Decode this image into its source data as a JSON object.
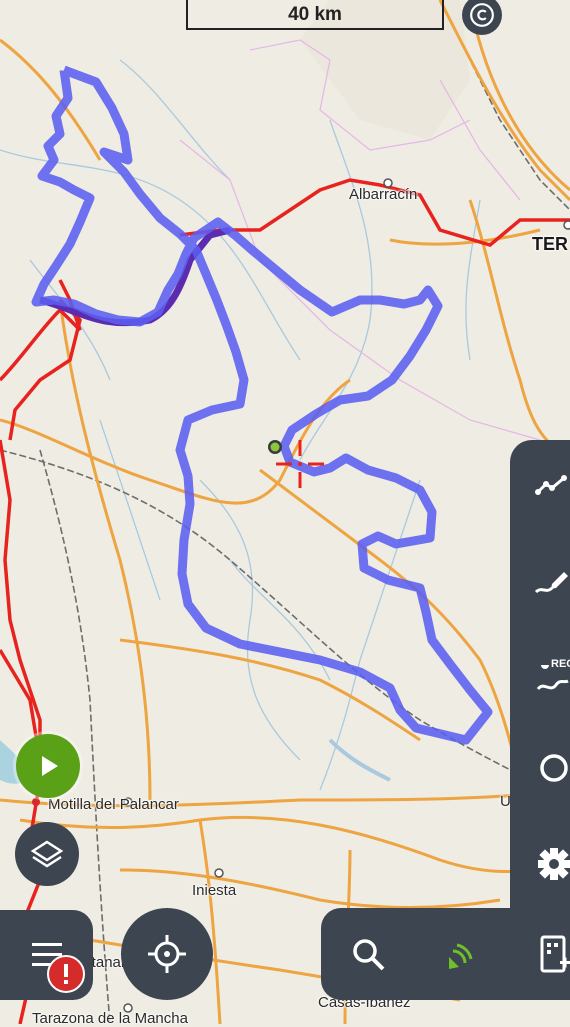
{
  "map": {
    "scale_label": "40 km",
    "places": [
      {
        "id": "albarracin",
        "name": "Albarracín"
      },
      {
        "id": "teruel",
        "name": "TER"
      },
      {
        "id": "motilla",
        "name": "Motilla del Palancar"
      },
      {
        "id": "utiel",
        "name": "Utiel"
      },
      {
        "id": "iniesta",
        "name": "Iniesta"
      },
      {
        "id": "quintanar",
        "name": "Quintanar del Rey"
      },
      {
        "id": "casas-ibanez",
        "name": "Casas-Ibáñez"
      },
      {
        "id": "tarazona",
        "name": "Tarazona de la Mancha"
      }
    ],
    "colors": {
      "background": "#efece3",
      "track": "#5b5ff0",
      "road_red": "#e8231f",
      "road_orange": "#eea440",
      "panel": "#3d4550",
      "play_button": "#5aa118",
      "alert": "#d62b2b"
    }
  },
  "controls": {
    "right_panel_items": [
      "track-line-icon",
      "track-draw-icon",
      "rec-track-icon",
      "search-map-icon",
      "settings-gear-icon"
    ],
    "rec_label": "REC",
    "bottom_left": [
      "menu-icon",
      "alert-icon"
    ],
    "center": "locate-crosshair-icon",
    "bottom_right": [
      "search-icon",
      "gps-signal-icon",
      "device-plus-icon"
    ]
  }
}
